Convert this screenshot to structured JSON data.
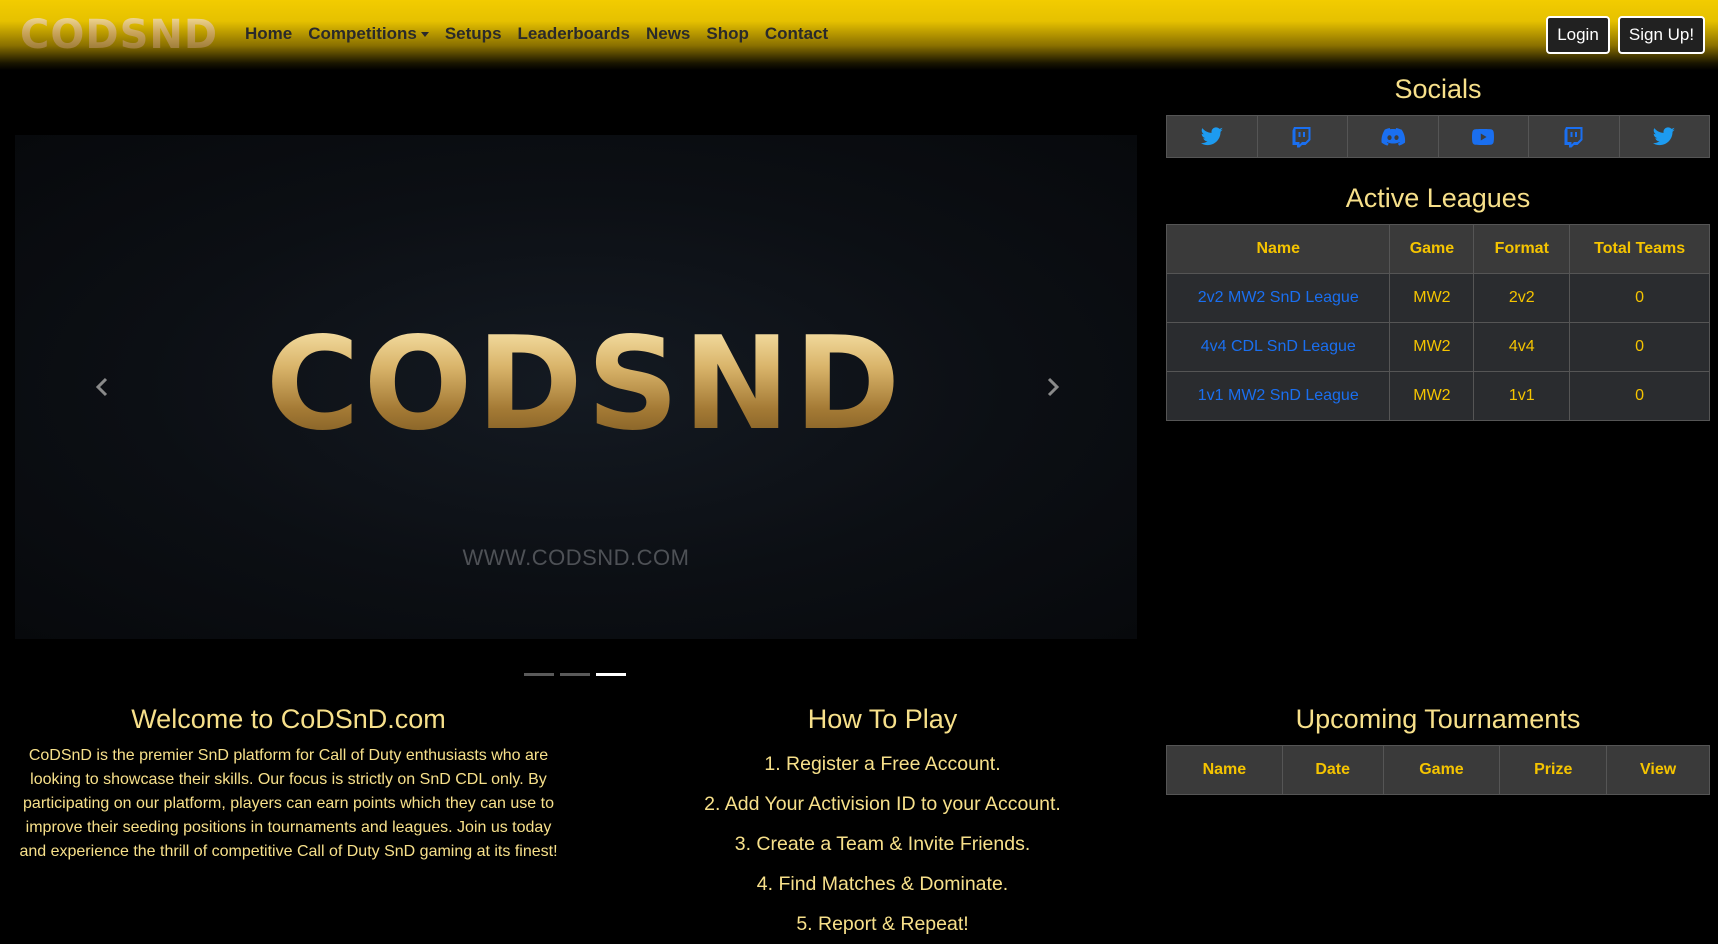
{
  "navbar": {
    "brand": "CODSND",
    "links": [
      "Home",
      "Competitions",
      "Setups",
      "Leaderboards",
      "News",
      "Shop",
      "Contact"
    ],
    "login_label": "Login",
    "signup_label": "Sign Up!"
  },
  "carousel": {
    "logo_text": "CODSND",
    "url_text": "WWW.CODSND.COM",
    "slide_count": 3,
    "active_slide": 3
  },
  "socials": {
    "title": "Socials",
    "icons": [
      "twitter-icon",
      "twitch-icon",
      "discord-icon",
      "youtube-icon",
      "twitch-icon",
      "twitter-icon"
    ]
  },
  "active_leagues": {
    "title": "Active Leagues",
    "columns": [
      "Name",
      "Game",
      "Format",
      "Total Teams"
    ],
    "rows": [
      [
        "2v2 MW2 SnD League",
        "MW2",
        "2v2",
        "0"
      ],
      [
        "4v4 CDL SnD League",
        "MW2",
        "4v4",
        "0"
      ],
      [
        "1v1 MW2 SnD League",
        "MW2",
        "1v1",
        "0"
      ]
    ]
  },
  "welcome": {
    "title": "Welcome to CoDSnD.com",
    "text": "CoDSnD is the premier SnD platform for Call of Duty enthusiasts who are looking to showcase their skills. Our focus is strictly on SnD CDL only. By participating on our platform, players can earn points which they can use to improve their seeding positions in tournaments and leagues. Join us today and experience the thrill of competitive Call of Duty SnD gaming at its finest!"
  },
  "how_to_play": {
    "title": "How To Play",
    "steps": [
      "1. Register a Free Account.",
      "2. Add Your Activision ID to your Account.",
      "3. Create a Team & Invite Friends.",
      "4. Find Matches & Dominate.",
      "5. Report & Repeat!"
    ]
  },
  "upcoming_tournaments": {
    "title": "Upcoming Tournaments",
    "columns": [
      "Name",
      "Date",
      "Game",
      "Prize",
      "View"
    ]
  },
  "colors": {
    "accent_yellow": "#f5c400",
    "text_gold": "#f7e08a",
    "link_blue": "#1a6ff0"
  }
}
